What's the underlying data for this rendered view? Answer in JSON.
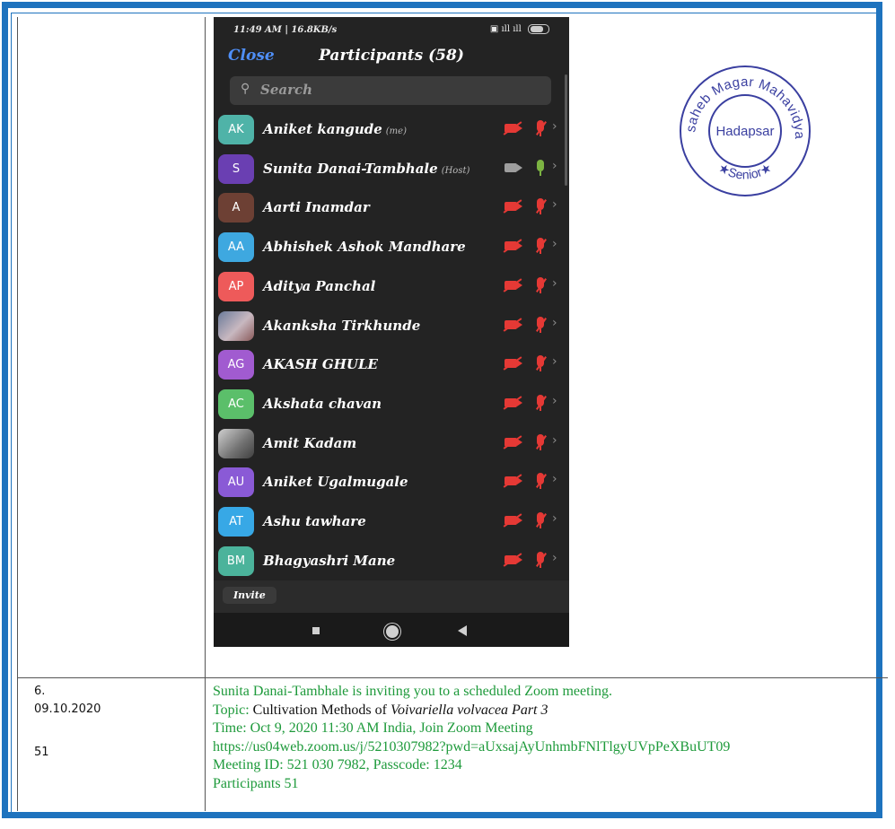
{
  "phone": {
    "status_left": "11:49 AM | 16.8KB/s",
    "battery_level": "81",
    "close_label": "Close",
    "title": "Participants (58)",
    "search_placeholder": "Search",
    "invite_label": "Invite",
    "participants": [
      {
        "initials": "AK",
        "name": "Aniket kangude",
        "tag": "(me)",
        "color": "#4fb3a8",
        "camera": "off",
        "mic": "off"
      },
      {
        "initials": "S",
        "name": "Sunita Danai-Tambhale",
        "tag": "(Host)",
        "color": "#6a3fb2",
        "camera": "on",
        "mic": "on"
      },
      {
        "initials": "A",
        "name": "Aarti Inamdar",
        "tag": "",
        "color": "#6d4034",
        "camera": "off",
        "mic": "off"
      },
      {
        "initials": "AA",
        "name": "Abhishek Ashok Mandhare",
        "tag": "",
        "color": "#3ea8e0",
        "camera": "off",
        "mic": "off"
      },
      {
        "initials": "AP",
        "name": "Aditya Panchal",
        "tag": "",
        "color": "#ee5a5a",
        "camera": "off",
        "mic": "off"
      },
      {
        "initials": "",
        "name": "Akanksha Tirkhunde",
        "tag": "",
        "color": "photo",
        "camera": "off",
        "mic": "off"
      },
      {
        "initials": "AG",
        "name": "AKASH GHULE",
        "tag": "",
        "color": "#a15bd0",
        "camera": "off",
        "mic": "off"
      },
      {
        "initials": "AC",
        "name": "Akshata chavan",
        "tag": "",
        "color": "#5bbf6a",
        "camera": "off",
        "mic": "off"
      },
      {
        "initials": "",
        "name": "Amit Kadam",
        "tag": "",
        "color": "photo2",
        "camera": "off",
        "mic": "off"
      },
      {
        "initials": "AU",
        "name": "Aniket Ugalmugale",
        "tag": "",
        "color": "#8a5ad6",
        "camera": "off",
        "mic": "off"
      },
      {
        "initials": "AT",
        "name": "Ashu tawhare",
        "tag": "",
        "color": "#37a8e6",
        "camera": "off",
        "mic": "off"
      },
      {
        "initials": "BM",
        "name": "Bhagyashri Mane",
        "tag": "",
        "color": "#4bb39b",
        "camera": "off",
        "mic": "off"
      }
    ]
  },
  "seal": {
    "ring_text": "Annasaheb Magar Mahavidyalaya",
    "center_text": "Hadapsar",
    "bottom_text": "★Senior★",
    "color": "#3a3fa0"
  },
  "row6": {
    "serial": "6.",
    "date": "09.10.2020",
    "count": "51",
    "line1": "Sunita Danai-Tambhale is inviting you to a scheduled Zoom meeting.",
    "topic_label": "Topic: ",
    "topic_c": "C",
    "topic_rest": "ultivation Methods of ",
    "topic_italic": "Voivariella volvacea Part 3",
    "time": "Time: Oct 9, 2020 11:30 AM India, Join Zoom Meeting",
    "url": "https://us04web.zoom.us/j/5210307982?pwd=aUxsajAyUnhmbFNlTlgyUVpPeXBuUT09",
    "meeting": "Meeting ID: 521 030 7982, Passcode: 1234",
    "participants": "Participants 51"
  }
}
